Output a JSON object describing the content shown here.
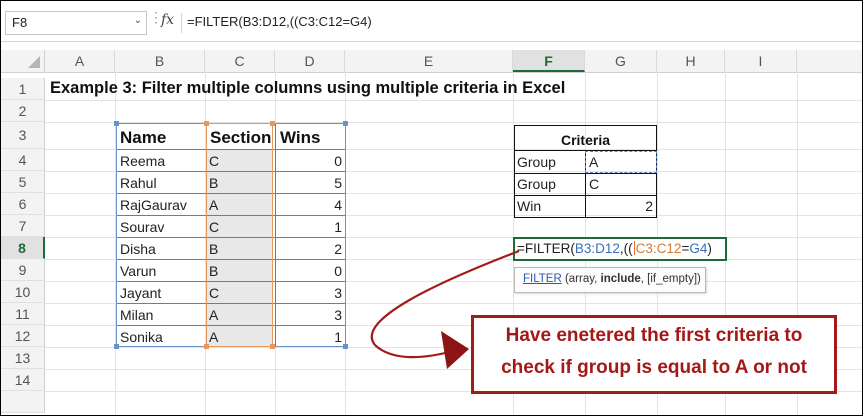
{
  "formula_bar": {
    "name_box": "F8",
    "fx": "fx",
    "formula": "=FILTER(B3:D12,((C3:C12=G4)"
  },
  "columns": [
    "A",
    "B",
    "C",
    "D",
    "E",
    "F",
    "G",
    "H",
    "I"
  ],
  "selected_column": "F",
  "rows": [
    "1",
    "2",
    "3",
    "4",
    "5",
    "6",
    "7",
    "8",
    "9",
    "10",
    "11",
    "12",
    "13",
    "14"
  ],
  "selected_row": "8",
  "title": "Example 3: Filter multiple columns using multiple criteria in Excel",
  "table": {
    "headers": [
      "Name",
      "Section",
      "Wins"
    ],
    "rows": [
      {
        "name": "Reema",
        "section": "C",
        "wins": "0"
      },
      {
        "name": "Rahul",
        "section": "B",
        "wins": "5"
      },
      {
        "name": "RajGaurav",
        "section": "A",
        "wins": "4"
      },
      {
        "name": "Sourav",
        "section": "C",
        "wins": "1"
      },
      {
        "name": "Disha",
        "section": "B",
        "wins": "2"
      },
      {
        "name": "Varun",
        "section": "B",
        "wins": "0"
      },
      {
        "name": "Jayant",
        "section": "C",
        "wins": "3"
      },
      {
        "name": "Milan",
        "section": "A",
        "wins": "3"
      },
      {
        "name": "Sonika",
        "section": "A",
        "wins": "1"
      }
    ]
  },
  "criteria": {
    "title": "Criteria",
    "rows": [
      {
        "label": "Group",
        "value": "A"
      },
      {
        "label": "Group",
        "value": "C"
      },
      {
        "label": "Win",
        "value": "2"
      }
    ]
  },
  "cell_formula": {
    "prefix": "=FILTER(",
    "ref1": "B3:D12",
    "mid": ",((",
    "ref2_a": "C",
    "ref2_b": "3:C12",
    "eq": "=",
    "ref3": "G4",
    "suffix": ")"
  },
  "tooltip": {
    "fn": "FILTER",
    "args_open": " (array, ",
    "current_arg": "include",
    "args_close": ", [if_empty])"
  },
  "callout": {
    "line1": "Have enetered the first criteria to",
    "line2": "check if group is equal to A or not"
  },
  "colors": {
    "selection_green": "#1e6b3a",
    "ref_blue": "#3a6fb8",
    "ref_orange": "#d07a3a",
    "callout_red": "#a31a1a"
  }
}
